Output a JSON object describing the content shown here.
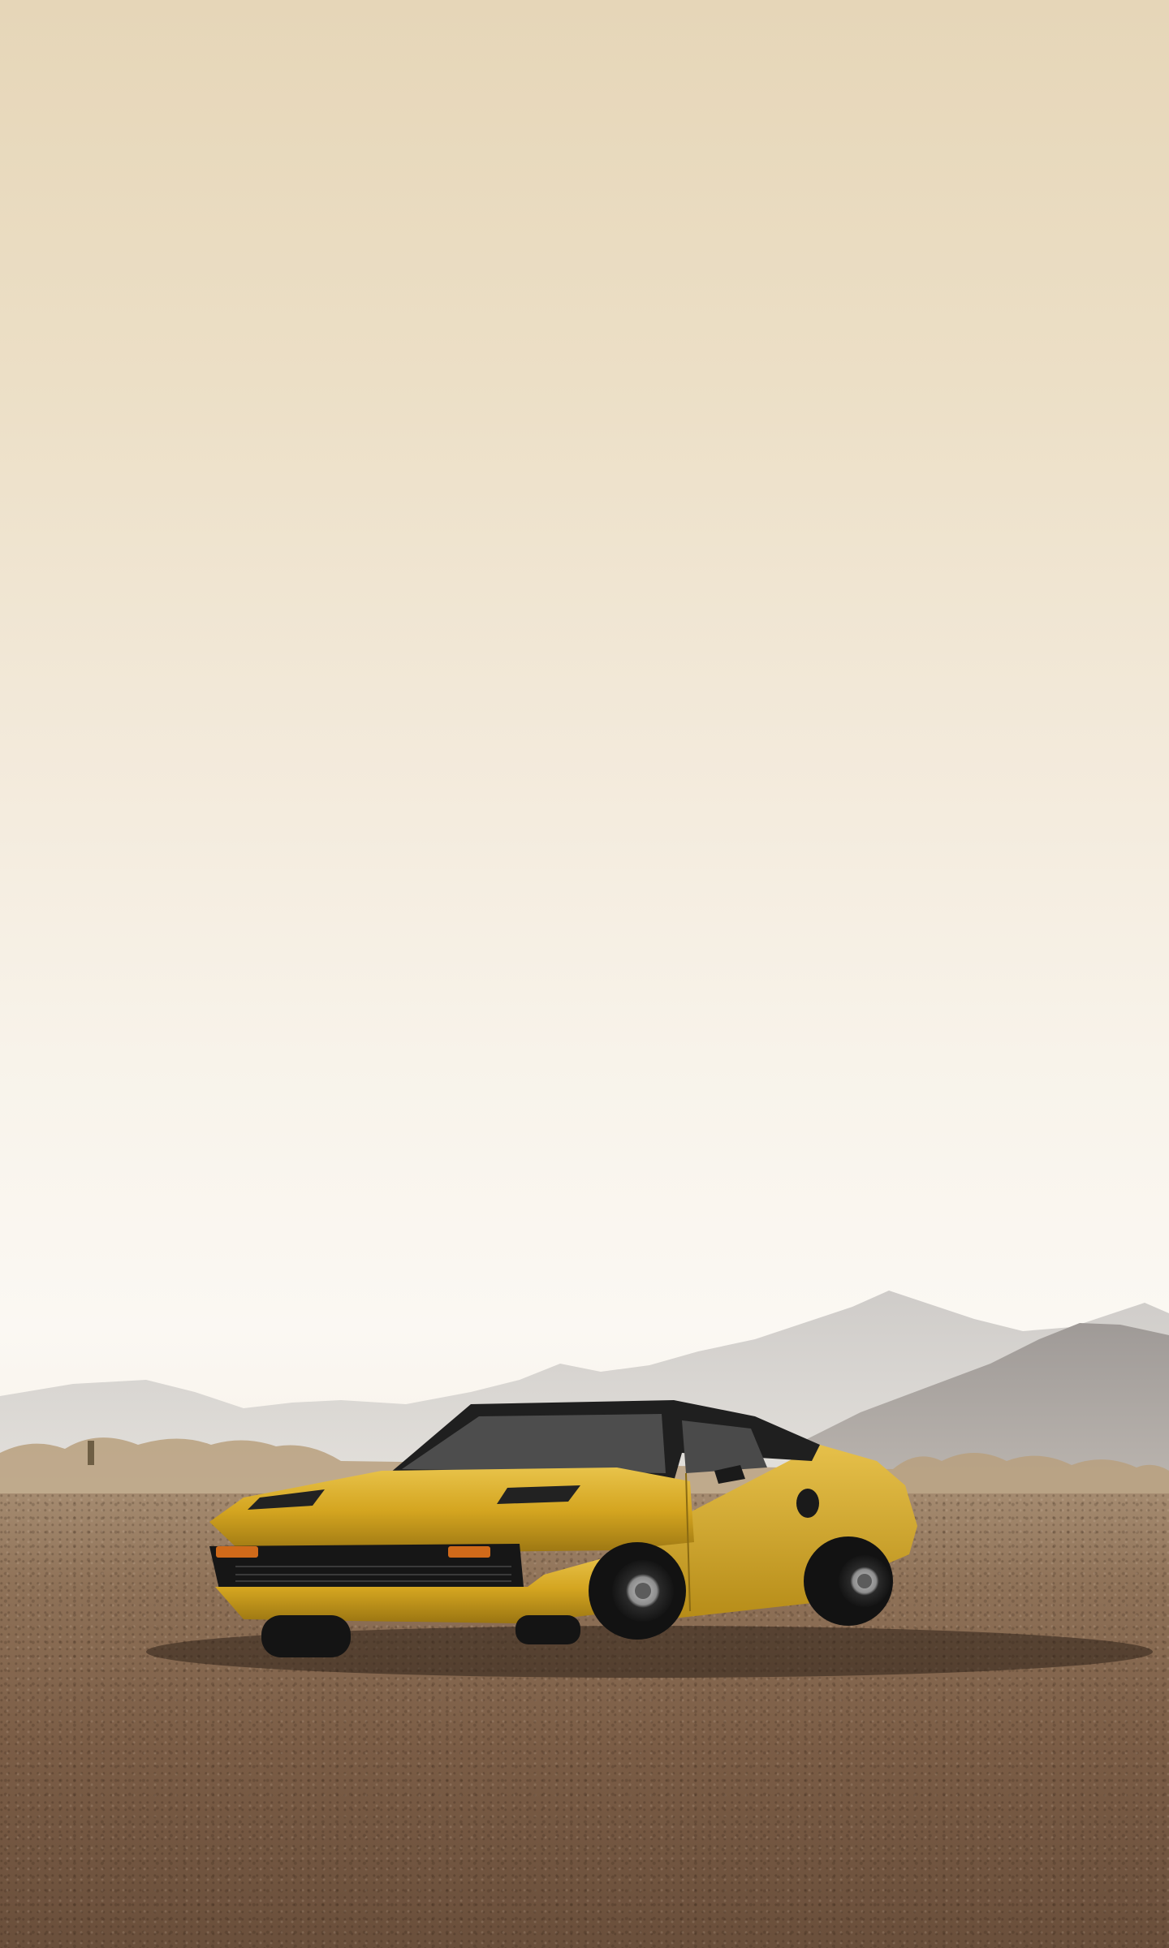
{
  "scene": {
    "subject": "yellow-sports-car",
    "colors": {
      "sky_top": "#e6d6b8",
      "sky_bottom": "#fbf8f3",
      "mountains_far": "#d9d6d2",
      "mountains_near": "#a8a3a0",
      "ground": "#7b5d46",
      "car_body": "#d4a520",
      "car_shadow": "#8a6a12",
      "glass": "#1c1c1c"
    }
  }
}
